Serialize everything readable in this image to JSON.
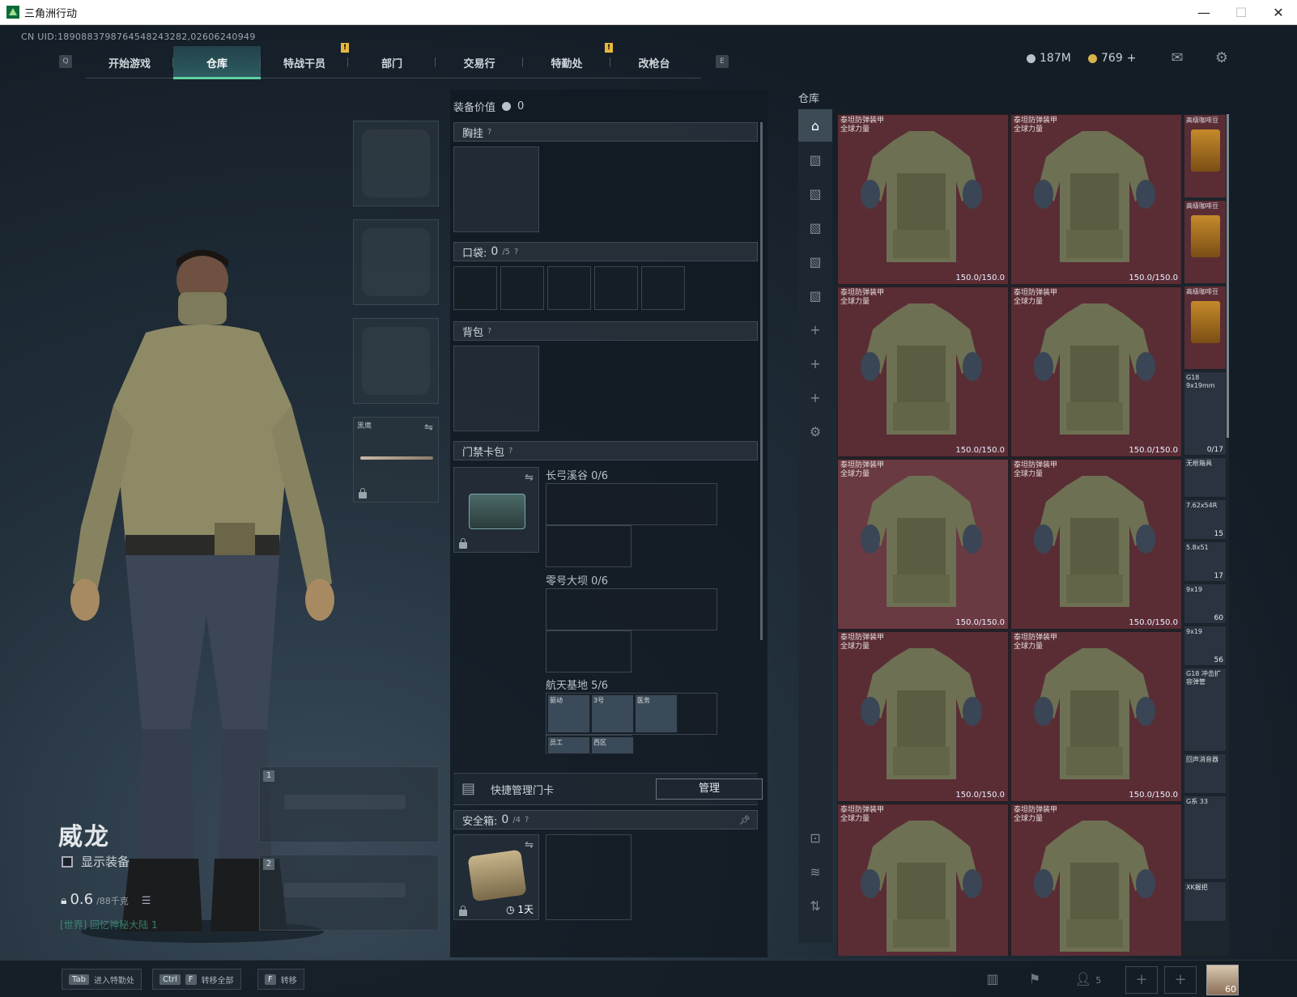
{
  "window": {
    "title": "三角洲行动",
    "controls": [
      "—",
      "☐",
      "✕"
    ]
  },
  "uid": "CN UID:1890883798764548243282,02606240949",
  "nav": {
    "left_key": "Q",
    "right_key": "E",
    "tabs": [
      {
        "label": "开始游戏",
        "active": false
      },
      {
        "label": "仓库",
        "active": true
      },
      {
        "label": "特战干员",
        "active": false
      },
      {
        "label": "部门",
        "active": false
      },
      {
        "label": "交易行",
        "active": false
      },
      {
        "label": "特勤处",
        "active": false
      },
      {
        "label": "改枪台",
        "active": false
      }
    ],
    "badge": "!"
  },
  "currency": {
    "silver": "187M",
    "gold": "769",
    "gold_plus": "+"
  },
  "character": {
    "name": "威龙",
    "show_equipment_label": "显示装备",
    "weight_value": "0.6",
    "weight_unit": "/88千克",
    "world_message": "[世界] 回忆神秘大陆 1"
  },
  "equip_slots": {
    "melee_label": "黑鹰",
    "weapon_1": "1",
    "weapon_2": "2"
  },
  "loadout": {
    "value_label": "装备价值",
    "value": "0",
    "chest_rig": "胸挂",
    "pocket": "口袋:",
    "pocket_count": "0",
    "pocket_max": "/5",
    "backpack": "背包",
    "keycard_case": "门禁卡包",
    "help": "?",
    "maps": [
      {
        "name": "长弓溪谷",
        "count": "0/6"
      },
      {
        "name": "零号大坝",
        "count": "0/6"
      },
      {
        "name": "航天基地",
        "count": "5/6"
      }
    ],
    "space_cards": [
      "驱动",
      "3号",
      "医务",
      "员工",
      "西区"
    ],
    "quick_manage_label": "快捷管理门卡",
    "manage_button": "管理",
    "safe_box": "安全箱:",
    "safe_count": "0",
    "safe_max": "/4",
    "safe_timer": "1天"
  },
  "warehouse": {
    "title": "仓库",
    "armor_name_line1": "泰坦防弹装甲",
    "armor_name_line2": "全球力量",
    "durability": "150.0/150.0",
    "side_items": [
      {
        "name": "高级咖啡豆",
        "count": ""
      },
      {
        "name": "高级咖啡豆",
        "count": ""
      },
      {
        "name": "高级咖啡豆",
        "count": ""
      },
      {
        "name": "G18 9x19mm",
        "count": "0/17"
      },
      {
        "name": "无框箱具",
        "count": ""
      },
      {
        "name": "7.62x54R",
        "count": "15"
      },
      {
        "name": "5.8x51",
        "count": "17"
      },
      {
        "name": "9x19",
        "count": "60"
      },
      {
        "name": "9x19",
        "count": "56"
      },
      {
        "name": "G18 冲击扩容弹管",
        "count": ""
      },
      {
        "name": "回声消音器",
        "count": ""
      },
      {
        "name": "G系 33",
        "count": ""
      },
      {
        "name": "XK握把",
        "count": ""
      }
    ]
  },
  "bottom": {
    "hints": [
      {
        "key": "Tab",
        "key2": "",
        "label": "进入特勤处"
      },
      {
        "key": "Ctrl",
        "key2": "F",
        "label": "转移全部"
      },
      {
        "key": "F",
        "key2": "",
        "label": "转移"
      }
    ],
    "friends": "5",
    "level": "60"
  }
}
